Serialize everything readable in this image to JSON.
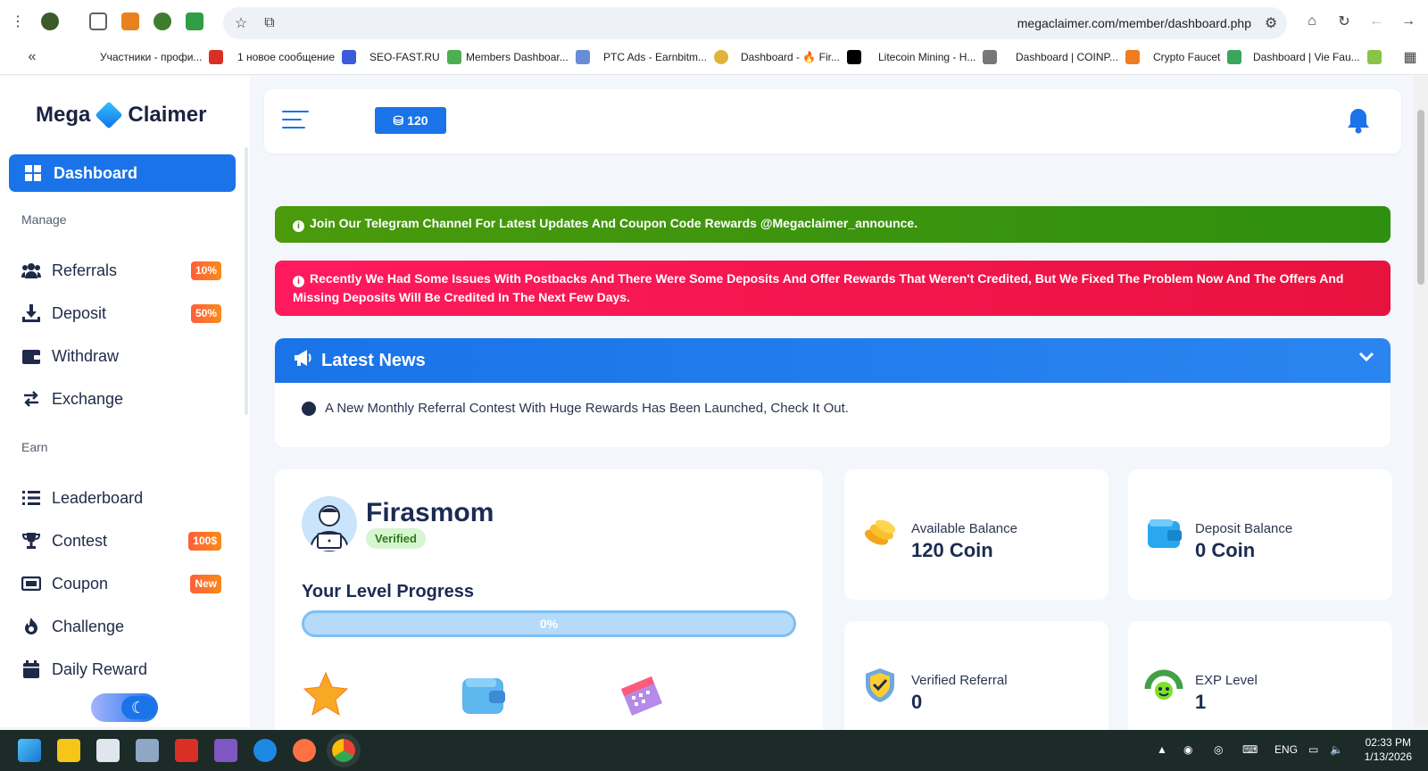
{
  "browser": {
    "url": "megaclaimer.com/member/dashboard.php",
    "bookmarks": [
      {
        "label": "Участники - профи...",
        "color": "#d93025"
      },
      {
        "label": "1 новое сообщение",
        "color": "#3b5bdb"
      },
      {
        "label": "SEO-FAST.RU",
        "color": "#4caf50"
      },
      {
        "label": "Members Dashboar...",
        "color": "#6a8bd6"
      },
      {
        "label": "PTC Ads - Earnbitm...",
        "color": "#e0b33a"
      },
      {
        "label": "Dashboard - 🔥 Fir...",
        "color": "#000000"
      },
      {
        "label": "Litecoin Mining - H...",
        "color": "#777777"
      },
      {
        "label": "Dashboard | COINP...",
        "color": "#f07c22"
      },
      {
        "label": "Crypto Faucet",
        "color": "#3aa65b"
      },
      {
        "label": "Dashboard | Vie Fau...",
        "color": "#8bc34a"
      }
    ]
  },
  "sidebar": {
    "logo_left": "Mega",
    "logo_right": "Claimer",
    "active": "Dashboard",
    "section_manage": "Manage",
    "section_earn": "Earn",
    "manage_items": [
      {
        "label": "Referrals",
        "badge": "10%",
        "icon": "users-icon"
      },
      {
        "label": "Deposit",
        "badge": "50%",
        "icon": "download-icon"
      },
      {
        "label": "Withdraw",
        "badge": "",
        "icon": "wallet-icon"
      },
      {
        "label": "Exchange",
        "badge": "",
        "icon": "exchange-icon"
      }
    ],
    "earn_items": [
      {
        "label": "Leaderboard",
        "badge": "",
        "icon": "list-icon"
      },
      {
        "label": "Contest",
        "badge": "100$",
        "icon": "trophy-icon"
      },
      {
        "label": "Coupon",
        "badge": "New",
        "icon": "ticket-icon"
      },
      {
        "label": "Challenge",
        "badge": "",
        "icon": "fire-icon"
      },
      {
        "label": "Daily Reward",
        "badge": "",
        "icon": "calendar-icon"
      }
    ]
  },
  "topbar": {
    "coins": "120"
  },
  "alerts": {
    "telegram": "Join Our Telegram Channel For Latest Updates And Coupon Code Rewards @Megaclaimer_announce.",
    "postbacks": "Recently We Had Some Issues With Postbacks And There Were Some Deposits And Offer Rewards That Weren't Credited, But We Fixed The Problem Now And The Offers And Missing Deposits Will Be Credited In The Next Few Days."
  },
  "news": {
    "title": "Latest News",
    "item": "A New Monthly Referral Contest With Huge Rewards Has Been Launched, Check It Out."
  },
  "profile": {
    "username": "Firasmom",
    "status": "Verified",
    "level_title": "Your Level Progress",
    "progress_label": "0%",
    "progress_value": 0
  },
  "stats": {
    "available_label": "Available Balance",
    "available_value": "120 Coin",
    "deposit_label": "Deposit Balance",
    "deposit_value": "0 Coin",
    "referral_label": "Verified Referral",
    "referral_value": "0",
    "exp_label": "EXP Level",
    "exp_value": "1"
  },
  "taskbar": {
    "lang": "ENG",
    "time": "02:33 PM",
    "date": "1/13/2026"
  },
  "colors": {
    "accent": "#1a73e8",
    "alert_green": "#3a950e",
    "alert_red": "#f0184a",
    "badge_orange": "#fb6a2e"
  }
}
